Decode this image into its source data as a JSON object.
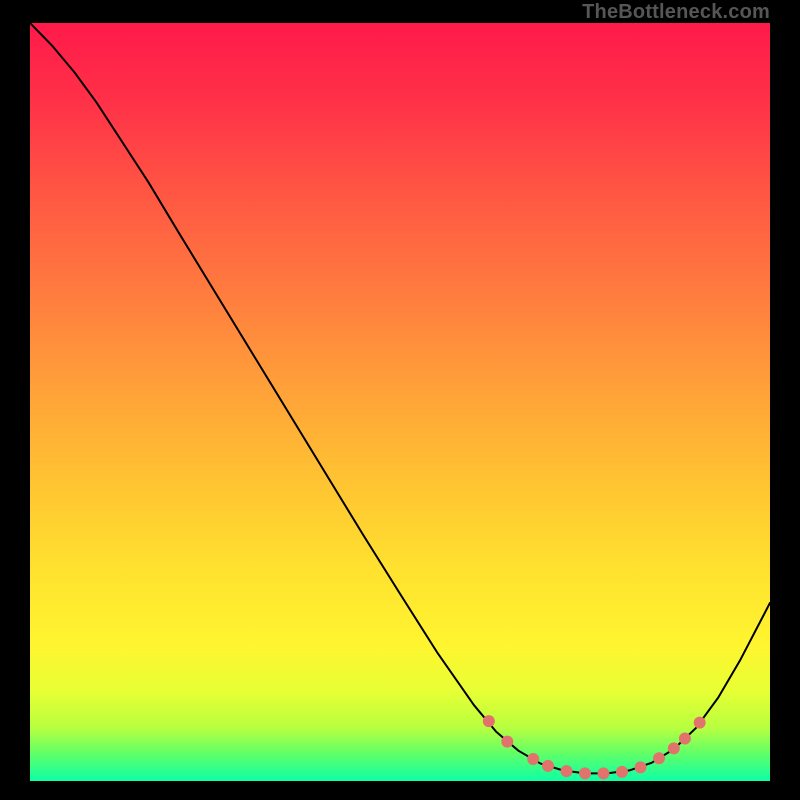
{
  "watermark": "TheBottleneck.com",
  "chart_data": {
    "type": "line",
    "title": "",
    "xlabel": "",
    "ylabel": "",
    "xlim": [
      0,
      100
    ],
    "ylim": [
      0,
      100
    ],
    "grid": false,
    "gradient_stops": [
      {
        "offset": 0.0,
        "color": "#ff1a4a"
      },
      {
        "offset": 0.1,
        "color": "#ff3048"
      },
      {
        "offset": 0.22,
        "color": "#ff5543"
      },
      {
        "offset": 0.35,
        "color": "#ff7a3f"
      },
      {
        "offset": 0.48,
        "color": "#ffa039"
      },
      {
        "offset": 0.6,
        "color": "#ffc232"
      },
      {
        "offset": 0.72,
        "color": "#ffe12f"
      },
      {
        "offset": 0.82,
        "color": "#fff52f"
      },
      {
        "offset": 0.88,
        "color": "#e8ff34"
      },
      {
        "offset": 0.93,
        "color": "#b8ff3f"
      },
      {
        "offset": 0.965,
        "color": "#5dff6a"
      },
      {
        "offset": 1.0,
        "color": "#0dffa6"
      }
    ],
    "series": [
      {
        "name": "curve",
        "stroke": "#000000",
        "stroke_width": 2,
        "points": [
          {
            "x": 0.0,
            "y": 100.0
          },
          {
            "x": 3.0,
            "y": 97.0
          },
          {
            "x": 6.0,
            "y": 93.5
          },
          {
            "x": 9.0,
            "y": 89.5
          },
          {
            "x": 12.0,
            "y": 85.0
          },
          {
            "x": 16.0,
            "y": 79.0
          },
          {
            "x": 20.0,
            "y": 72.5
          },
          {
            "x": 25.0,
            "y": 64.5
          },
          {
            "x": 30.0,
            "y": 56.5
          },
          {
            "x": 35.0,
            "y": 48.5
          },
          {
            "x": 40.0,
            "y": 40.5
          },
          {
            "x": 45.0,
            "y": 32.5
          },
          {
            "x": 50.0,
            "y": 24.7
          },
          {
            "x": 55.0,
            "y": 17.0
          },
          {
            "x": 60.0,
            "y": 10.0
          },
          {
            "x": 63.0,
            "y": 6.5
          },
          {
            "x": 66.0,
            "y": 4.0
          },
          {
            "x": 69.0,
            "y": 2.3
          },
          {
            "x": 72.0,
            "y": 1.4
          },
          {
            "x": 75.0,
            "y": 1.0
          },
          {
            "x": 78.0,
            "y": 1.0
          },
          {
            "x": 81.0,
            "y": 1.4
          },
          {
            "x": 84.0,
            "y": 2.4
          },
          {
            "x": 87.0,
            "y": 4.2
          },
          {
            "x": 90.0,
            "y": 7.0
          },
          {
            "x": 93.0,
            "y": 11.0
          },
          {
            "x": 96.0,
            "y": 16.0
          },
          {
            "x": 100.0,
            "y": 23.5
          }
        ]
      },
      {
        "name": "dots",
        "stroke": "#e2736c",
        "marker_radius": 6,
        "points": [
          {
            "x": 62.0,
            "y": 7.9
          },
          {
            "x": 64.5,
            "y": 5.2
          },
          {
            "x": 68.0,
            "y": 2.9
          },
          {
            "x": 70.0,
            "y": 2.0
          },
          {
            "x": 72.5,
            "y": 1.3
          },
          {
            "x": 75.0,
            "y": 1.0
          },
          {
            "x": 77.5,
            "y": 1.0
          },
          {
            "x": 80.0,
            "y": 1.2
          },
          {
            "x": 82.5,
            "y": 1.8
          },
          {
            "x": 85.0,
            "y": 3.0
          },
          {
            "x": 87.0,
            "y": 4.3
          },
          {
            "x": 88.5,
            "y": 5.6
          },
          {
            "x": 90.5,
            "y": 7.7
          }
        ]
      }
    ]
  }
}
